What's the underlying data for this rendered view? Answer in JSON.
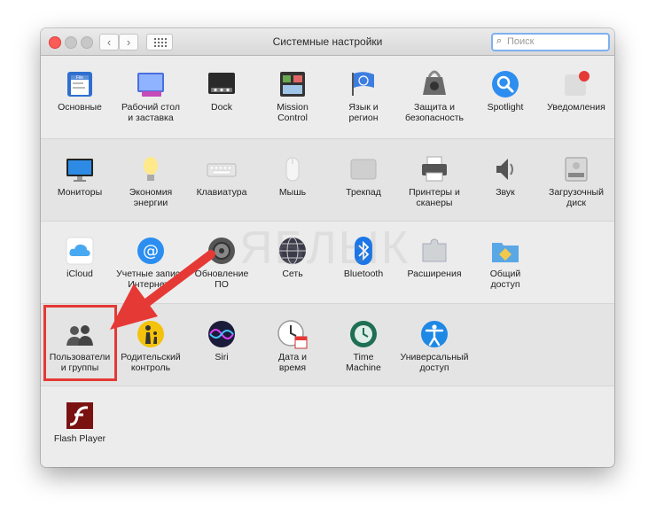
{
  "window": {
    "title": "Системные настройки"
  },
  "toolbar": {
    "back": "‹",
    "forward": "›",
    "search_placeholder": "Поиск"
  },
  "watermark": "ЯБЛЫК",
  "rows": [
    {
      "items": [
        {
          "icon": "general-icon",
          "label": "Основные"
        },
        {
          "icon": "desktop-screensaver-icon",
          "label": "Рабочий стол\nи заставка"
        },
        {
          "icon": "dock-icon",
          "label": "Dock"
        },
        {
          "icon": "mission-control-icon",
          "label": "Mission\nControl"
        },
        {
          "icon": "language-region-icon",
          "label": "Язык и\nрегион"
        },
        {
          "icon": "security-privacy-icon",
          "label": "Защита и\nбезопасность"
        },
        {
          "icon": "spotlight-icon",
          "label": "Spotlight"
        },
        {
          "icon": "notifications-icon",
          "label": "Уведомления"
        }
      ]
    },
    {
      "items": [
        {
          "icon": "displays-icon",
          "label": "Мониторы"
        },
        {
          "icon": "energy-saver-icon",
          "label": "Экономия\nэнергии"
        },
        {
          "icon": "keyboard-icon",
          "label": "Клавиатура"
        },
        {
          "icon": "mouse-icon",
          "label": "Мышь"
        },
        {
          "icon": "trackpad-icon",
          "label": "Трекпад"
        },
        {
          "icon": "printers-scanners-icon",
          "label": "Принтеры и\nсканеры"
        },
        {
          "icon": "sound-icon",
          "label": "Звук"
        },
        {
          "icon": "startup-disk-icon",
          "label": "Загрузочный\nдиск"
        }
      ]
    },
    {
      "items": [
        {
          "icon": "icloud-icon",
          "label": "iCloud"
        },
        {
          "icon": "internet-accounts-icon",
          "label": "Учетные записи\nИнтернета"
        },
        {
          "icon": "software-update-icon",
          "label": "Обновление\nПО"
        },
        {
          "icon": "network-icon",
          "label": "Сеть"
        },
        {
          "icon": "bluetooth-icon",
          "label": "Bluetooth"
        },
        {
          "icon": "extensions-icon",
          "label": "Расширения"
        },
        {
          "icon": "sharing-icon",
          "label": "Общий\nдоступ"
        }
      ]
    },
    {
      "items": [
        {
          "icon": "users-groups-icon",
          "label": "Пользователи\nи группы"
        },
        {
          "icon": "parental-controls-icon",
          "label": "Родительский\nконтроль"
        },
        {
          "icon": "siri-icon",
          "label": "Siri"
        },
        {
          "icon": "date-time-icon",
          "label": "Дата и\nвремя"
        },
        {
          "icon": "time-machine-icon",
          "label": "Time\nMachine"
        },
        {
          "icon": "accessibility-icon",
          "label": "Универсальный\nдоступ"
        }
      ]
    },
    {
      "items": [
        {
          "icon": "flash-player-icon",
          "label": "Flash Player"
        }
      ]
    }
  ],
  "colors": {
    "annotation": "#e53935",
    "search_focus": "#7fb0ef"
  }
}
